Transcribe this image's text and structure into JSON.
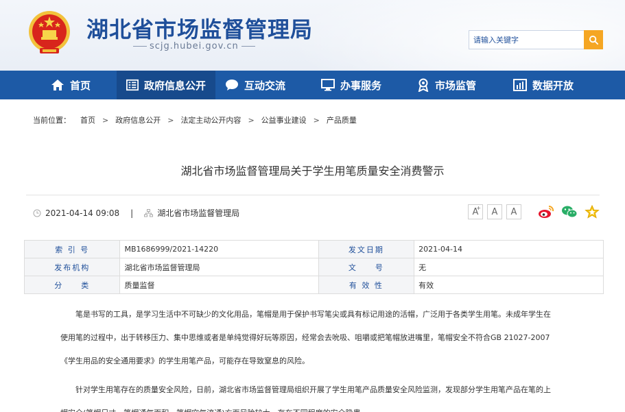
{
  "header": {
    "title": "湖北省市场监督管理局",
    "domain": "scjg.hubei.gov.cn",
    "search_placeholder": "请输入关键字"
  },
  "nav": {
    "items": [
      {
        "label": "首页",
        "icon": "home-icon"
      },
      {
        "label": "政府信息公开",
        "icon": "document-list-icon"
      },
      {
        "label": "互动交流",
        "icon": "chat-bubble-icon"
      },
      {
        "label": "办事服务",
        "icon": "monitor-icon"
      },
      {
        "label": "市场监管",
        "icon": "badge-icon"
      },
      {
        "label": "数据开放",
        "icon": "bar-chart-icon"
      }
    ],
    "active_index": 1
  },
  "breadcrumb": {
    "prefix": "当前位置：",
    "items": [
      "首页",
      "政府信息公开",
      "法定主动公开内容",
      "公益事业建设",
      "产品质量"
    ],
    "separator": ">"
  },
  "article": {
    "title": "湖北省市场监督管理局关于学生用笔质量安全消费警示",
    "date": "2021-04-14 09:08",
    "pipe": "|",
    "source": "湖北省市场监督管理局",
    "font_buttons": [
      "A",
      "A",
      "A"
    ],
    "font_plus": "+",
    "share_icons": [
      "weibo-icon",
      "wechat-icon",
      "favorite-star-icon"
    ]
  },
  "info": {
    "rows": [
      {
        "l1": "索 引 号",
        "v1": "MB1686999/2021-14220",
        "l2": "发文日期",
        "v2": "2021-04-14"
      },
      {
        "l1": "发布机构",
        "v1": "湖北省市场监督管理局",
        "l2": "文　　号",
        "v2": "无"
      },
      {
        "l1": "分　　类",
        "v1": "质量监督",
        "l2": "有 效 性",
        "v2": "有效"
      }
    ]
  },
  "body": {
    "p1_l1": "笔是书写的工具，是学习生活中不可缺少的文化用品，笔帽是用于保护书写笔尖或具有标记用途的活帽，广泛用于各类学生用笔。未成年学生在",
    "p1_l2": "使用笔的过程中，出于转移压力、集中思维或者是单纯觉得好玩等原因，经常会去吮吸、咀嚼或把笔帽放进嘴里，笔帽安全不符合GB 21027-2007",
    "p1_l3": "《学生用品的安全通用要求》的学生用笔产品，可能存在导致窒息的风险。",
    "p2_l1": "针对学生用笔存在的质量安全风险，日前，湖北省市场监督管理局组织开展了学生用笔产品质量安全风险监测，发现部分学生用笔产品在笔的上",
    "p2_l2": "帽安全(笔帽尺寸、笔帽通气面积、笔帽空气流通)方面风险较大，存在不同程度的安全隐患。"
  },
  "colors": {
    "brand_blue": "#1d5aa6",
    "nav_active": "#174a8c",
    "title_blue": "#1f4f9a",
    "search_orange": "#f5a623"
  }
}
